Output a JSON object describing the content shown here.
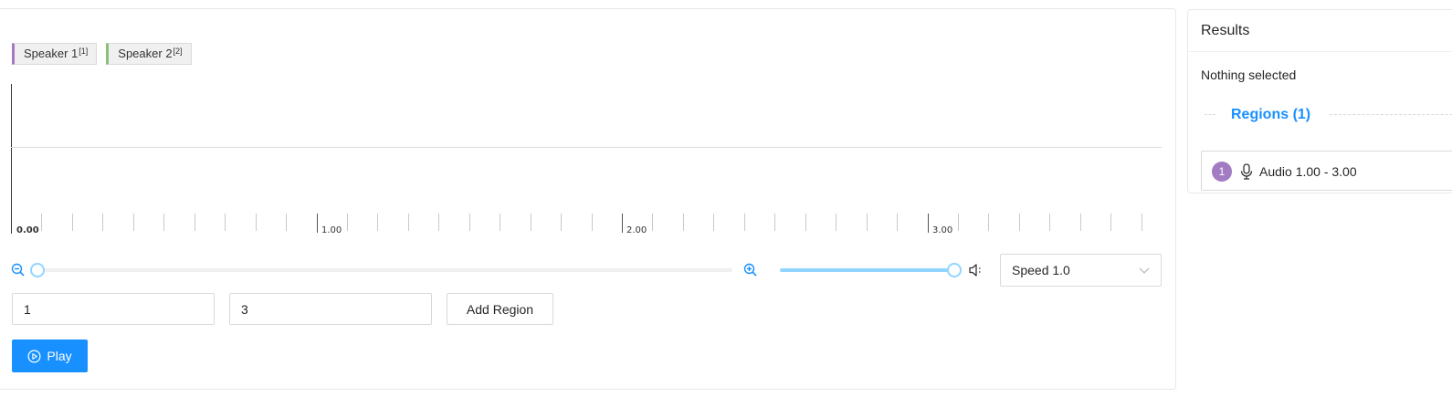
{
  "labels": [
    {
      "name": "Speaker 1",
      "hotkey": "[1]",
      "color": "#a37bc2"
    },
    {
      "name": "Speaker 2",
      "hotkey": "[2]",
      "color": "#8ac07a"
    }
  ],
  "timeline": {
    "tick_labels": [
      "0.00",
      "1.00",
      "2.00",
      "3.00"
    ]
  },
  "zoom": {
    "level": 0
  },
  "volume": {
    "level": 1.0
  },
  "speed": {
    "selected": "Speed 1.0"
  },
  "region_form": {
    "start_value": "1",
    "end_value": "3",
    "add_label": "Add Region"
  },
  "play_label": "Play",
  "results": {
    "title": "Results",
    "nothing_selected": "Nothing selected",
    "regions_heading": "Regions (1)",
    "regions": [
      {
        "index": "1",
        "text": "Audio 1.00 - 3.00",
        "color": "#a37bc2"
      }
    ]
  },
  "colors": {
    "primary": "#1890ff",
    "slider": "#91d5ff"
  }
}
